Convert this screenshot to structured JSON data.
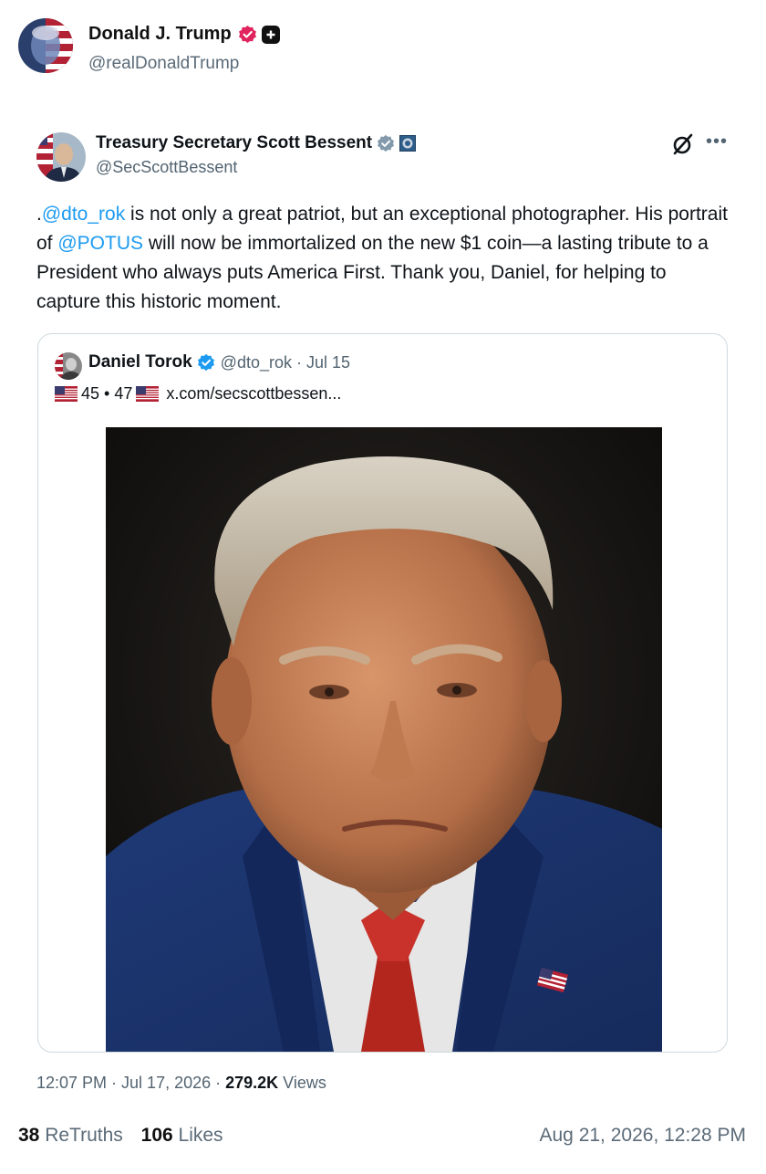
{
  "post": {
    "display_name": "Donald J. Trump",
    "handle": "@realDonaldTrump"
  },
  "embedded": {
    "display_name": "Treasury Secretary Scott Bessent",
    "handle": "@SecScottBessent",
    "text_parts": [
      {
        "text": ".",
        "mention": false
      },
      {
        "text": "@dto_rok",
        "mention": true
      },
      {
        "text": " is not only a great patriot, but an exceptional photographer. His portrait of ",
        "mention": false
      },
      {
        "text": "@POTUS",
        "mention": true
      },
      {
        "text": " will now be immortalized on the new $1 coin—a lasting tribute to a President who always puts America First. Thank you, Daniel, for helping to capture this historic moment.",
        "mention": false
      }
    ],
    "timestamp": "12:07 PM · Jul 17, 2026 · ",
    "views_count": "279.2K",
    "views_label": " Views"
  },
  "quote": {
    "display_name": "Daniel Torok",
    "meta": "@dto_rok · Jul 15",
    "line2_numbers": "45 • 47",
    "line2_link": "x.com/secscottbessen..."
  },
  "stats": {
    "retruths_count": "38",
    "retruths_label": "ReTruths",
    "likes_count": "106",
    "likes_label": "Likes"
  },
  "footer_date": "Aug 21, 2026, 12:28 PM",
  "colors": {
    "mention": "#1d9bf0",
    "verified_pink": "#e0245e",
    "verified_gray": "#829aab",
    "verified_blue": "#1d9bf0",
    "muted": "#536471"
  }
}
